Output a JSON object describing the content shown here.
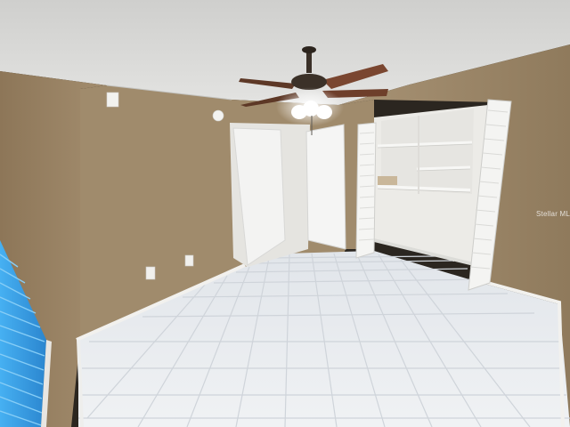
{
  "photo": {
    "watermark_text": "Stellar MLS",
    "colors": {
      "ceiling": "#d9d9d7",
      "wall": "#a08b6c",
      "wall_shadow": "#8a7559",
      "floor_tile": "#e9ecef",
      "grout": "#cfd4da",
      "door": "#f1f1f0",
      "trim": "#ecebe8",
      "blinds": "#3fa6ea"
    },
    "objects": [
      "ceiling-fan",
      "bedroom-door",
      "closet-bifold-doors",
      "closet-shelves",
      "window-blinds",
      "tile-floor",
      "electrical-outlet",
      "thermostat"
    ]
  }
}
